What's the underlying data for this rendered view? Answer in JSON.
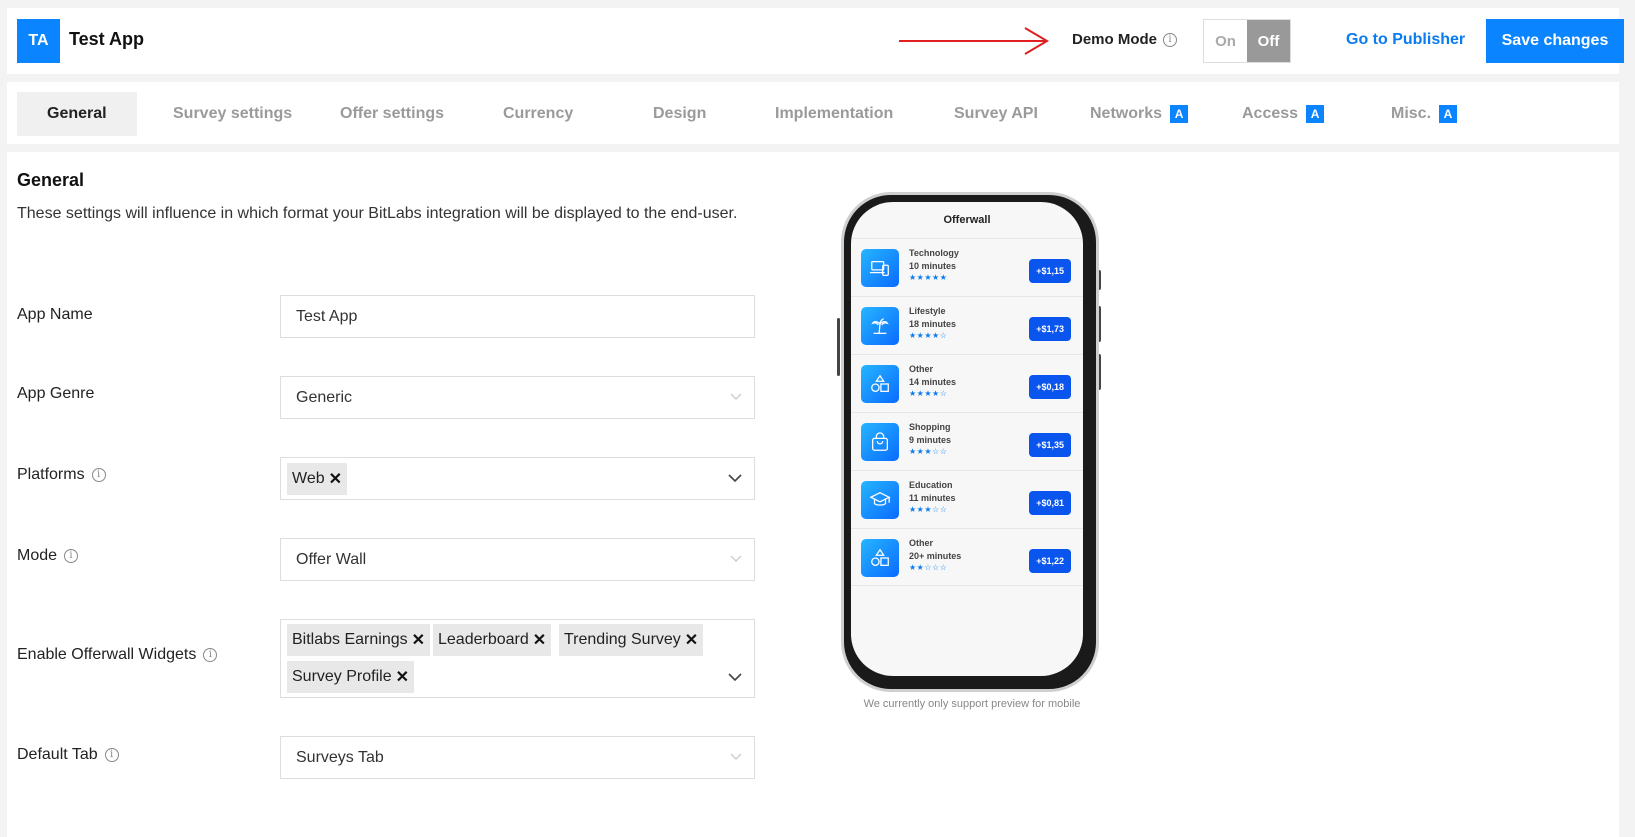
{
  "header": {
    "logo_initials": "TA",
    "app_title": "Test App",
    "demo_mode_label": "Demo Mode",
    "toggle_on": "On",
    "toggle_off": "Off",
    "toggle_state": "Off",
    "go_to_publisher": "Go to Publisher",
    "save_changes": "Save changes"
  },
  "tabs": [
    {
      "label": "General",
      "active": true,
      "badge": ""
    },
    {
      "label": "Survey settings",
      "badge": ""
    },
    {
      "label": "Offer settings",
      "badge": ""
    },
    {
      "label": "Currency",
      "badge": ""
    },
    {
      "label": "Design",
      "badge": ""
    },
    {
      "label": "Implementation",
      "badge": ""
    },
    {
      "label": "Survey API",
      "badge": ""
    },
    {
      "label": "Networks",
      "badge": "A"
    },
    {
      "label": "Access",
      "badge": "A"
    },
    {
      "label": "Misc.",
      "badge": "A"
    }
  ],
  "general": {
    "title": "General",
    "description": "These settings will influence in which format your BitLabs integration will be displayed to the end-user."
  },
  "fields": {
    "app_name": {
      "label": "App Name",
      "value": "Test App"
    },
    "app_genre": {
      "label": "App Genre",
      "value": "Generic"
    },
    "platforms": {
      "label": "Platforms",
      "tags": [
        "Web"
      ]
    },
    "mode": {
      "label": "Mode",
      "value": "Offer Wall"
    },
    "widgets": {
      "label": "Enable Offerwall Widgets",
      "tags": [
        "Bitlabs Earnings",
        "Leaderboard",
        "Trending Survey",
        "Survey Profile"
      ]
    },
    "default_tab": {
      "label": "Default Tab",
      "value": "Surveys Tab"
    }
  },
  "preview": {
    "screen_title": "Offerwall",
    "offers": [
      {
        "category": "Technology",
        "time": "10 minutes",
        "rating": 5,
        "price": "+$1,15",
        "icon": "devices-icon"
      },
      {
        "category": "Lifestyle",
        "time": "18 minutes",
        "rating": 4,
        "price": "+$1,73",
        "icon": "palm-tree-icon"
      },
      {
        "category": "Other",
        "time": "14 minutes",
        "rating": 4,
        "price": "+$0,18",
        "icon": "shapes-icon"
      },
      {
        "category": "Shopping",
        "time": "9 minutes",
        "rating": 3,
        "price": "+$1,35",
        "icon": "shopping-bag-icon"
      },
      {
        "category": "Education",
        "time": "11 minutes",
        "rating": 3,
        "price": "+$0,81",
        "icon": "graduation-cap-icon"
      },
      {
        "category": "Other",
        "time": "20+ minutes",
        "rating": 2,
        "price": "+$1,22",
        "icon": "shapes-icon"
      }
    ],
    "note": "We currently only support preview for mobile"
  },
  "colors": {
    "accent": "#0a84ff",
    "link": "#0a7cf0",
    "price_badge": "#0a55ee",
    "annotation_arrow": "#e02020"
  }
}
